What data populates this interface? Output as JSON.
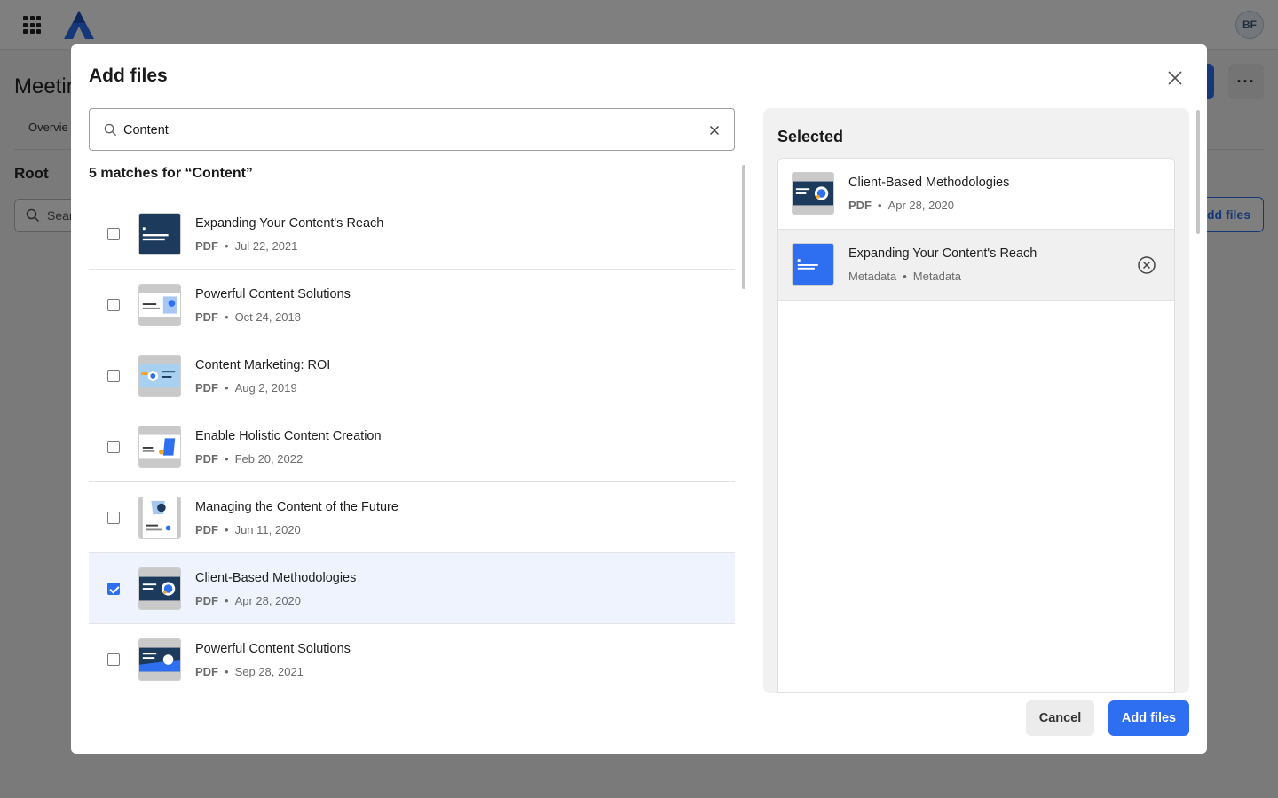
{
  "background": {
    "avatar_initials": "BF",
    "page_title": "Meetin",
    "tab_overview": "Overvie",
    "section_root": "Root",
    "search_placeholder": "Sear",
    "add_files_button": "dd files"
  },
  "modal": {
    "title": "Add files",
    "search": {
      "value": "Content"
    },
    "match_count": "5 matches for “Content”",
    "results": [
      {
        "name": "Expanding Your Content's Reach",
        "type": "PDF",
        "date": "Jul 22, 2021",
        "checked": false
      },
      {
        "name": "Powerful Content Solutions",
        "type": "PDF",
        "date": "Oct 24, 2018",
        "checked": false
      },
      {
        "name": "Content Marketing: ROI",
        "type": "PDF",
        "date": "Aug 2, 2019",
        "checked": false
      },
      {
        "name": "Enable Holistic Content Creation",
        "type": "PDF",
        "date": "Feb 20, 2022",
        "checked": false
      },
      {
        "name": "Managing the Content of the Future",
        "type": "PDF",
        "date": "Jun 11, 2020",
        "checked": false
      },
      {
        "name": "Client-Based Methodologies",
        "type": "PDF",
        "date": "Apr 28, 2020",
        "checked": true
      },
      {
        "name": "Powerful Content Solutions",
        "type": "PDF",
        "date": "Sep 28, 2021",
        "checked": false
      }
    ],
    "selected_title": "Selected",
    "selected": [
      {
        "name": "Client-Based Methodologies",
        "type": "PDF",
        "date": "Apr 28, 2020"
      },
      {
        "name": "Expanding Your Content's Reach",
        "type": "Metadata",
        "date": "Metadata"
      }
    ],
    "cancel_label": "Cancel",
    "add_label": "Add files"
  },
  "colors": {
    "accent": "#2d6ff0",
    "selected_row": "#eef3fd"
  }
}
